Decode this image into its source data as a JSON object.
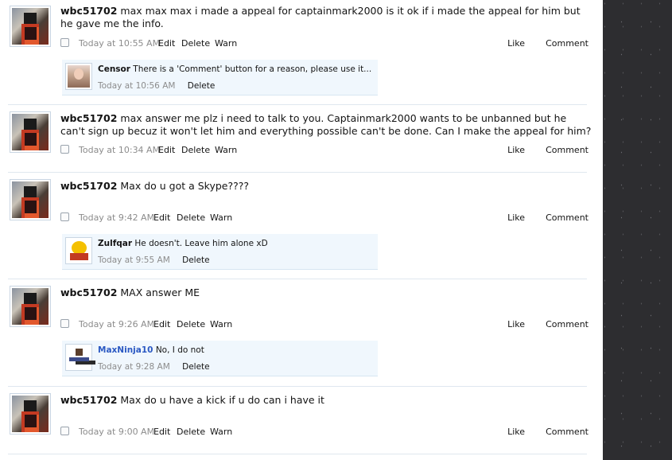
{
  "posts": [
    {
      "username": "wbc51702",
      "message": "max max max i made a appeal for captainmark2000 is it ok if i made the appeal for him but he gave me the info.",
      "timestamp": "Today at 10:55 AM",
      "actions": {
        "edit": "Edit",
        "delete": "Delete",
        "warn": "Warn",
        "like": "Like",
        "comment": "Comment"
      },
      "reply": {
        "username": "Censor",
        "text": "There is a 'Comment' button for a reason, please use it...",
        "timestamp": "Today at 10:56 AM",
        "delete": "Delete"
      }
    },
    {
      "username": "wbc51702",
      "message": "max answer me plz i need to talk to you. Captainmark2000 wants to be unbanned but he can't sign up becuz it won't let him and everything possible can't be done. Can I make the appeal for him?",
      "timestamp": "Today at 10:34 AM",
      "actions": {
        "edit": "Edit",
        "delete": "Delete",
        "warn": "Warn",
        "like": "Like",
        "comment": "Comment"
      }
    },
    {
      "username": "wbc51702",
      "message": "Max do u got a Skype????",
      "timestamp": "Today at 9:42 AM",
      "actions": {
        "edit": "Edit",
        "delete": "Delete",
        "warn": "Warn",
        "like": "Like",
        "comment": "Comment"
      },
      "reply": {
        "username": "Zulfqar",
        "text": "He doesn't. Leave him alone xD",
        "timestamp": "Today at 9:55 AM",
        "delete": "Delete"
      }
    },
    {
      "username": "wbc51702",
      "message": "MAX answer ME",
      "timestamp": "Today at 9:26 AM",
      "actions": {
        "edit": "Edit",
        "delete": "Delete",
        "warn": "Warn",
        "like": "Like",
        "comment": "Comment"
      },
      "reply": {
        "username": "MaxNinja10",
        "text": "No, I do not",
        "timestamp": "Today at 9:28 AM",
        "delete": "Delete"
      }
    },
    {
      "username": "wbc51702",
      "message": "Max do u have a kick if u do can i have it",
      "timestamp": "Today at 9:00 AM",
      "actions": {
        "edit": "Edit",
        "delete": "Delete",
        "warn": "Warn",
        "like": "Like",
        "comment": "Comment"
      }
    }
  ]
}
